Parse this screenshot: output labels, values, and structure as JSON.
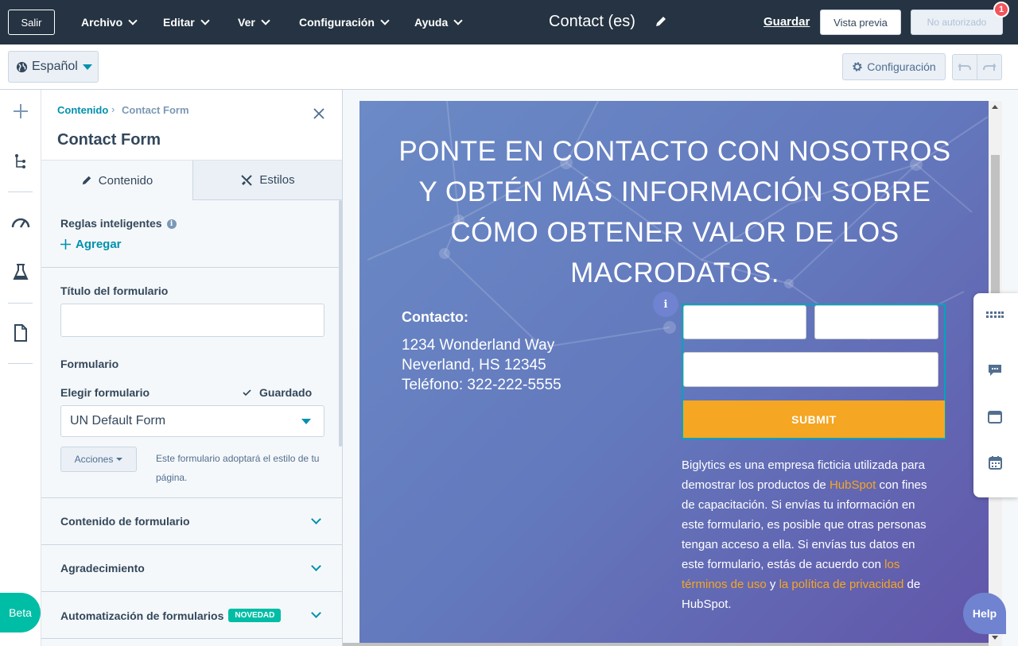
{
  "topbar": {
    "exit_label": "Salir",
    "menus": [
      "Archivo",
      "Editar",
      "Ver",
      "Configuración",
      "Ayuda"
    ],
    "page_name": "Contact (es)",
    "save_label": "Guardar",
    "preview_label": "Vista previa",
    "publish_label": "No autorizado",
    "notification_count": "1"
  },
  "subbar": {
    "language": "Español",
    "settings_label": "Configuración"
  },
  "sidebar": {
    "beta_label": "Beta"
  },
  "panel": {
    "breadcrumb_root": "Contenido",
    "breadcrumb_sep": "›",
    "breadcrumb_current": "Contact Form",
    "title": "Contact Form",
    "tabs": [
      {
        "label": "Contenido"
      },
      {
        "label": "Estilos"
      }
    ],
    "smart_rules_label": "Reglas inteligentes",
    "add_label": "Agregar",
    "form_title_label": "Título del formulario",
    "form_title_value": "",
    "form_section_label": "Formulario",
    "choose_form_label": "Elegir formulario",
    "saved_label": "Guardado",
    "selected_form": "UN Default Form",
    "actions_label": "Acciones",
    "style_note": "Este formulario adoptará el estilo de tu página.",
    "accordions": [
      {
        "label": "Contenido de formulario"
      },
      {
        "label": "Agradecimiento"
      },
      {
        "label": "Automatización de formularios",
        "badge": "NOVEDAD"
      }
    ]
  },
  "preview": {
    "hero_title": "PONTE EN CONTACTO CON NOSOTROS Y OBTÉN MÁS INFORMACIÓN SOBRE CÓMO OBTENER VALOR DE LOS MACRODATOS.",
    "contact_heading": "Contacto:",
    "address_line1": "1234 Wonderland Way",
    "address_line2": "Neverland, HS 12345",
    "phone_line": "Teléfono: 322-222-5555",
    "info_badge": "i",
    "submit_label": "SUBMIT",
    "disclaimer": {
      "part1": "Biglytics es una empresa ficticia utilizada para demostrar los productos de ",
      "link1": "HubSpot",
      "part2": " con fines de capacitación. Si envías tu información en este formulario, es posible que otras personas tengan acceso a ella. Si envías tus datos en este formulario, estás de acuerdo con ",
      "link2": "los términos de uso",
      "part3": " y ",
      "link3": "la política de privacidad",
      "part4": " de HubSpot."
    }
  },
  "help_label": "Help",
  "colors": {
    "nav_bg": "#253342",
    "accent": "#0091ae",
    "submit": "#f5a623",
    "beta": "#00bda5",
    "badge_red": "#f2545b"
  }
}
